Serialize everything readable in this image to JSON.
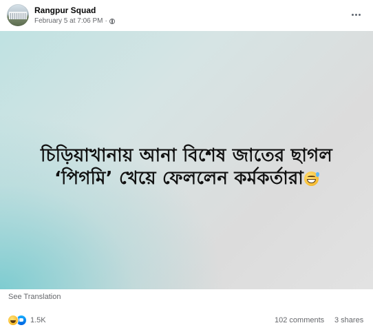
{
  "post": {
    "author": "Rangpur Squad",
    "timestamp": "February 5 at 7:06 PM",
    "separator": "·",
    "privacy_icon": "globe-icon",
    "more_icon": "more-options-icon"
  },
  "image": {
    "headline_line1": "চিড়িয়াখানায় আনা বিশেষ জাতের ছাগল",
    "headline_line2": "‘পিগমি’ খেয়ে ফেললেন কর্মকর্তারা",
    "headline_emoji": "grinning-sweat-emoji",
    "background_colors": [
      "#7fcfd3",
      "#dcdcdc"
    ]
  },
  "see_translation": "See Translation",
  "footer": {
    "reaction_icons": [
      "haha-icon",
      "like-icon"
    ],
    "reaction_count": "1.5K",
    "comments": "102 comments",
    "shares": "3 shares"
  }
}
